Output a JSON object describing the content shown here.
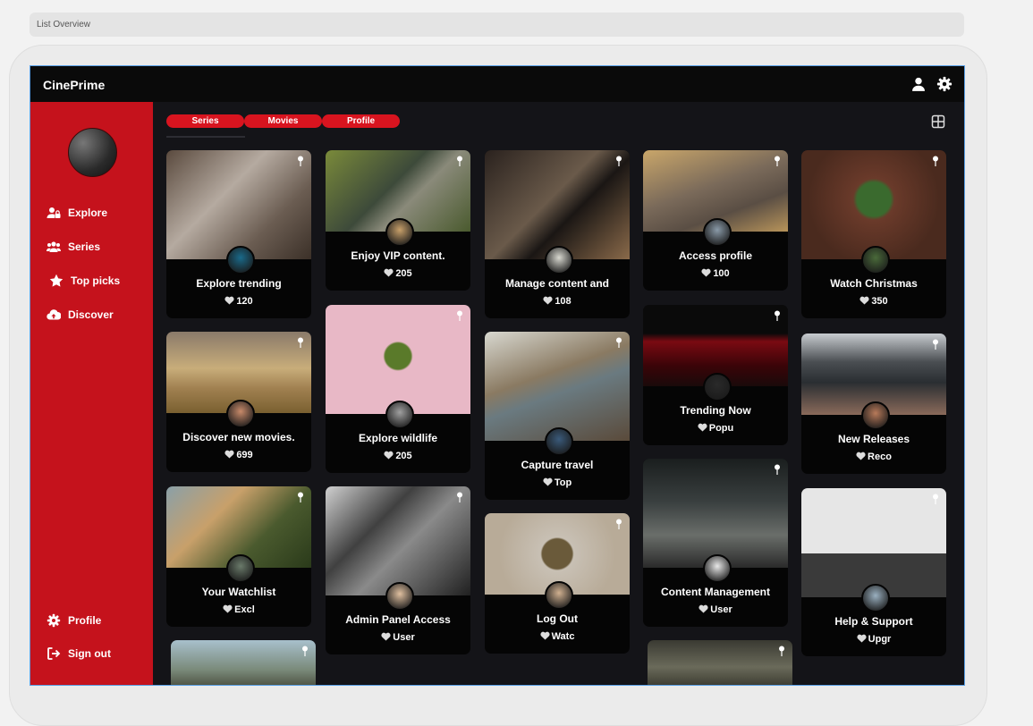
{
  "window": {
    "title": "List Overview"
  },
  "brand": "CinePrime",
  "header_icons": [
    "user-icon",
    "gear-icon"
  ],
  "sidebar": {
    "items": [
      {
        "label": "Explore",
        "icon": "user-lock-icon"
      },
      {
        "label": "Series",
        "icon": "users-icon"
      },
      {
        "label": "Top picks",
        "icon": "star-icon"
      },
      {
        "label": "Discover",
        "icon": "cloud-upload-icon"
      }
    ],
    "bottom": [
      {
        "label": "Profile",
        "icon": "gear-icon"
      },
      {
        "label": "Sign out",
        "icon": "sign-out-icon"
      }
    ]
  },
  "tabs": [
    "Series",
    "Movies",
    "Profile"
  ],
  "colors": {
    "accent": "#c5121c",
    "background": "#141418",
    "card": "#050505"
  },
  "cards": [
    {
      "title": "Explore trending",
      "likes": "120"
    },
    {
      "title": "Enjoy VIP content.",
      "likes": "205"
    },
    {
      "title": "Manage content and",
      "likes": "108"
    },
    {
      "title": "Access profile",
      "likes": "100"
    },
    {
      "title": "Watch Christmas",
      "likes": "350"
    },
    {
      "title": "Discover new movies.",
      "likes": "699"
    },
    {
      "title": "Explore wildlife",
      "likes": "205"
    },
    {
      "title": "Capture travel",
      "likes": "Top"
    },
    {
      "title": "Trending Now",
      "likes": "Popu"
    },
    {
      "title": "New Releases",
      "likes": "Reco"
    },
    {
      "title": "Your Watchlist",
      "likes": "Excl"
    },
    {
      "title": "Admin Panel Access",
      "likes": "User"
    },
    {
      "title": "Log Out",
      "likes": "Watc"
    },
    {
      "title": "Content Management",
      "likes": "User"
    },
    {
      "title": "Help & Support",
      "likes": "Upgr"
    },
    {
      "title": "",
      "likes": ""
    },
    {
      "title": "",
      "likes": ""
    }
  ]
}
